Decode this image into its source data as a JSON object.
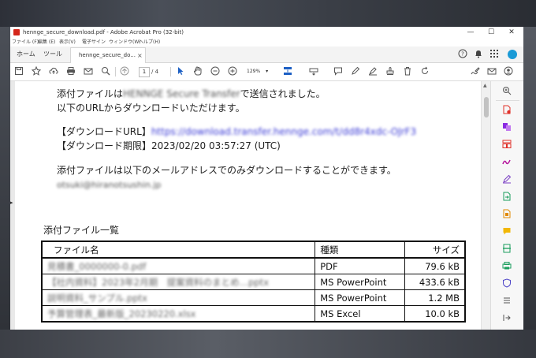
{
  "window": {
    "title": "hennge_secure_download.pdf - Adobe Acrobat Pro (32-bit)",
    "controls": {
      "minimize": "—",
      "maximize": "☐",
      "close": "✕"
    }
  },
  "menu": [
    "ファイル (F)",
    "編集 (E)",
    "表示(V)",
    "電子サイン",
    "ウィンドウ(W)",
    "ヘルプ(H)"
  ],
  "tabs": {
    "home": "ホーム",
    "tools": "ツール",
    "document": "hennge_secure_do...",
    "close": "×"
  },
  "toolbar": {
    "page_current": "1",
    "page_total": "/ 4",
    "zoom": "129%"
  },
  "document": {
    "line1_prefix": "添付ファイルは",
    "line1_sender": "HENNGE Secure Transfer",
    "line1_suffix": "で送信されました。",
    "line2": "以下のURLからダウンロードいただけます。",
    "url_label": "【ダウンロードURL】",
    "url_value": "https://download.transfer.hennge.com/t/dd8r4xdc-OJrF3",
    "expiry_label": "【ダウンロード期限】",
    "expiry_value": "2023/02/20 03:57:27 (UTC)",
    "notice": "添付ファイルは以下のメールアドレスでのみダウンロードすることができます。",
    "email": "otsuki@hiranotsushin.jp",
    "table_title": "添付ファイル一覧",
    "table_headers": [
      "ファイル名",
      "種類",
      "サイズ"
    ],
    "table_rows": [
      {
        "name": "見積書_0000000-0.pdf",
        "type": "PDF",
        "size": "79.6 kB"
      },
      {
        "name": "【社内資料】2023年2月期　提案資料のまとめ…pptx",
        "type": "MS PowerPoint",
        "size": "433.6 kB"
      },
      {
        "name": "説明資料_サンプル.pptx",
        "type": "MS PowerPoint",
        "size": "1.2 MB"
      },
      {
        "name": "予算管理表_最新版_20230220.xlsx",
        "type": "MS Excel",
        "size": "10.0 kB"
      }
    ]
  },
  "colors": {
    "acrobat_red": "#d4271b",
    "link": "#3b3bd6",
    "avatar": "#1a9ad6"
  }
}
